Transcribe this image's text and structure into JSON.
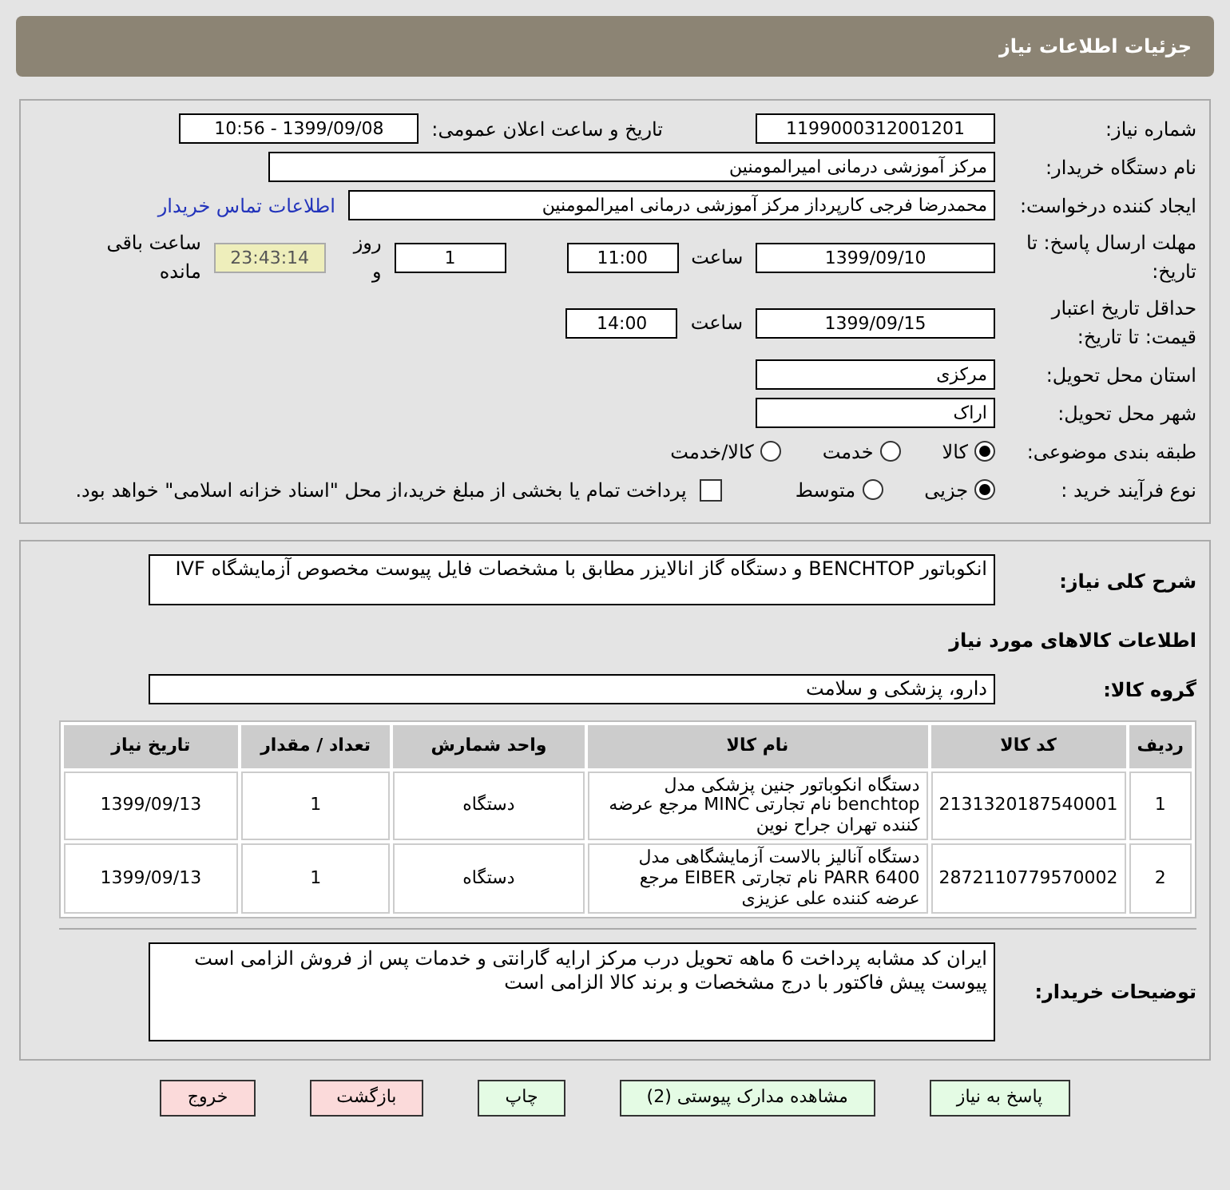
{
  "header": {
    "title": "جزئیات اطلاعات نیاز"
  },
  "need_number": {
    "label": "شماره نیاز:",
    "value": "1199000312001201"
  },
  "announce": {
    "label": "تاریخ و ساعت اعلان عمومی:",
    "value": "1399/09/08 - 10:56"
  },
  "buyer": {
    "label": "نام دستگاه خریدار:",
    "value": "مرکز آموزشی درمانی امیرالمومنین"
  },
  "creator": {
    "label": "ایجاد کننده درخواست:",
    "value": "محمدرضا فرجی کارپرداز مرکز آموزشی درمانی امیرالمومنین",
    "link": "اطلاعات تماس خریدار"
  },
  "deadline": {
    "label": "مهلت ارسال پاسخ: تا تاریخ:",
    "date": "1399/09/10",
    "time_label": "ساعت",
    "time": "11:00",
    "days": "1",
    "days_label": "روز و",
    "remaining": "23:43:14",
    "remaining_label": "ساعت باقی مانده"
  },
  "validity": {
    "label": "حداقل تاریخ اعتبار قیمت: تا تاریخ:",
    "date": "1399/09/15",
    "time_label": "ساعت",
    "time": "14:00"
  },
  "province": {
    "label": "استان محل تحویل:",
    "value": "مرکزی"
  },
  "city": {
    "label": "شهر محل تحویل:",
    "value": "اراک"
  },
  "category": {
    "label": "طبقه بندی موضوعی:",
    "options": [
      {
        "label": "کالا",
        "selected": true
      },
      {
        "label": "خدمت",
        "selected": false
      },
      {
        "label": "کالا/خدمت",
        "selected": false
      }
    ]
  },
  "process": {
    "label": "نوع فرآیند خرید :",
    "options": [
      {
        "label": "جزیی",
        "selected": true
      },
      {
        "label": "متوسط",
        "selected": false
      }
    ],
    "payment": {
      "label": "پرداخت تمام یا بخشی از مبلغ خرید،از محل \"اسناد خزانه اسلامی\" خواهد بود.",
      "checked": false
    }
  },
  "description": {
    "label": "شرح کلی نیاز:",
    "value": "انکوباتور BENCHTOP و دستگاه گاز انالایزر  مطابق با مشخصات فایل پیوست مخصوص آزمایشگاه IVF"
  },
  "goods_title": "اطلاعات کالاهای مورد نیاز",
  "goods_group": {
    "label": "گروه کالا:",
    "value": "دارو، پزشکی و سلامت"
  },
  "table": {
    "columns": [
      "ردیف",
      "کد کالا",
      "نام کالا",
      "واحد شمارش",
      "تعداد / مقدار",
      "تاریخ نیاز"
    ],
    "rows": [
      [
        "1",
        "2131320187540001",
        "دستگاه انکوباتور جنین پزشکی مدل benchtop نام تجارتی MINC مرجع عرضه کننده تهران جراح نوین",
        "دستگاه",
        "1",
        "1399/09/13"
      ],
      [
        "2",
        "2872110779570002",
        "دستگاه آنالیز بالاست آزمایشگاهی مدل PARR 6400 نام تجارتی EIBER مرجع عرضه کننده علی عزیزی",
        "دستگاه",
        "1",
        "1399/09/13"
      ]
    ]
  },
  "notes": {
    "label": "توضیحات خریدار:",
    "lines": [
      "ایران کد مشابه پرداخت 6 ماهه تحویل درب مرکز ارایه گارانتی و خدمات پس از فروش الزامی است",
      "پیوست پیش فاکتور با درج مشخصات و برند کالا الزامی است"
    ]
  },
  "buttons": [
    {
      "label": "پاسخ به نیاز",
      "kind": "action"
    },
    {
      "label": "مشاهده مدارک پیوستی (2)",
      "kind": "action"
    },
    {
      "label": "چاپ",
      "kind": "action"
    },
    {
      "label": "بازگشت",
      "kind": "exit"
    },
    {
      "label": "خروج",
      "kind": "exit"
    }
  ]
}
